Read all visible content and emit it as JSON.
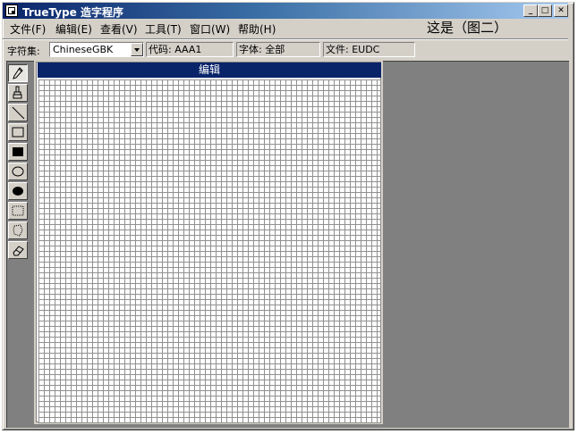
{
  "window": {
    "title": "TrueType 造字程序",
    "minimize_glyph": "_",
    "maximize_glyph": "□",
    "close_glyph": "✕"
  },
  "menu": {
    "items": [
      {
        "label": "文件(F)"
      },
      {
        "label": "编辑(E)"
      },
      {
        "label": "查看(V)"
      },
      {
        "label": "工具(T)"
      },
      {
        "label": "窗口(W)"
      },
      {
        "label": "帮助(H)"
      }
    ]
  },
  "annotation": "这是（图二）",
  "toolbar": {
    "charset_label": "字符集:",
    "charset_value": "ChineseGBK",
    "code_field": "代码: AAA1",
    "font_field": "字体: 全部",
    "file_field": "文件: EUDC"
  },
  "tools": [
    {
      "name": "pencil-tool-icon"
    },
    {
      "name": "brush-tool-icon"
    },
    {
      "name": "line-tool-icon"
    },
    {
      "name": "hollow-rectangle-tool-icon"
    },
    {
      "name": "filled-rectangle-tool-icon"
    },
    {
      "name": "hollow-ellipse-tool-icon"
    },
    {
      "name": "filled-ellipse-tool-icon"
    },
    {
      "name": "rectangular-selection-tool-icon"
    },
    {
      "name": "freeform-selection-tool-icon"
    },
    {
      "name": "eraser-tool-icon"
    }
  ],
  "editor": {
    "title": "编辑"
  },
  "colors": {
    "title_active": "#0a246a",
    "face": "#d4d0c8",
    "workspace": "#808080"
  }
}
